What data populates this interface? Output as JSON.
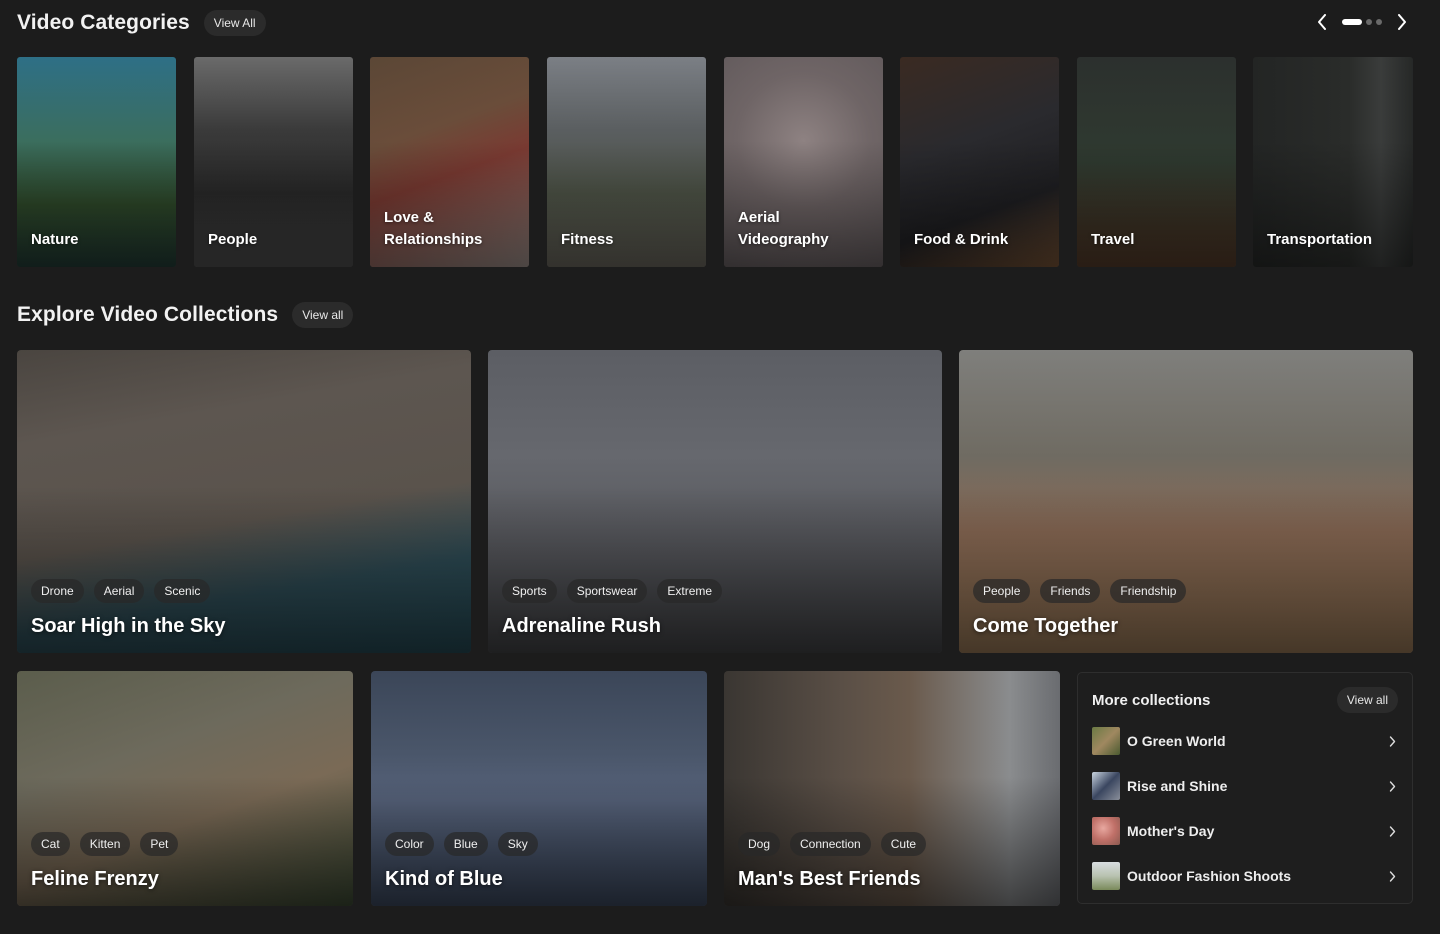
{
  "categories_section": {
    "title": "Video Categories",
    "view_all_label": "View All",
    "carousel": {
      "pages": 3,
      "active_page": 1
    },
    "items": [
      {
        "label": "Nature"
      },
      {
        "label": "People"
      },
      {
        "label": "Love & Relationships"
      },
      {
        "label": "Fitness"
      },
      {
        "label": "Aerial Videography"
      },
      {
        "label": "Food & Drink"
      },
      {
        "label": "Travel"
      },
      {
        "label": "Transportation"
      }
    ]
  },
  "collections_section": {
    "title": "Explore Video Collections",
    "view_all_label": "View all",
    "items": [
      {
        "title": "Soar High in the Sky",
        "tags": [
          "Drone",
          "Aerial",
          "Scenic"
        ]
      },
      {
        "title": "Adrenaline Rush",
        "tags": [
          "Sports",
          "Sportswear",
          "Extreme"
        ]
      },
      {
        "title": "Come Together",
        "tags": [
          "People",
          "Friends",
          "Friendship"
        ]
      },
      {
        "title": "Feline Frenzy",
        "tags": [
          "Cat",
          "Kitten",
          "Pet"
        ]
      },
      {
        "title": "Kind of Blue",
        "tags": [
          "Color",
          "Blue",
          "Sky"
        ]
      },
      {
        "title": "Man's Best Friends",
        "tags": [
          "Dog",
          "Connection",
          "Cute"
        ]
      }
    ]
  },
  "more_collections": {
    "title": "More collections",
    "view_all_label": "View all",
    "items": [
      {
        "label": "O Green World",
        "icon": "chevron-right-icon"
      },
      {
        "label": "Rise and Shine",
        "icon": "chevron-right-icon"
      },
      {
        "label": "Mother's Day",
        "icon": "chevron-right-icon"
      },
      {
        "label": "Outdoor Fashion Shoots",
        "icon": "chevron-right-icon"
      }
    ]
  },
  "colors": {
    "background": "#1c1c1c",
    "pill": "#2b2b2b",
    "text": "#ffffff"
  }
}
